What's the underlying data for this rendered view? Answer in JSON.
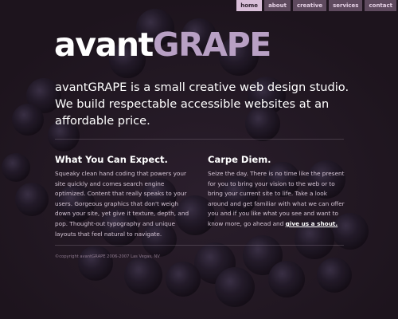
{
  "nav": {
    "items": [
      {
        "label": "home",
        "active": true
      },
      {
        "label": "about",
        "active": false
      },
      {
        "label": "creative",
        "active": false
      },
      {
        "label": "services",
        "active": false
      },
      {
        "label": "contact",
        "active": false
      }
    ]
  },
  "logo": {
    "part1": "avant",
    "part2": "GRAPE"
  },
  "intro": "avantGRAPE is a small creative web design studio. We build respectable accessible websites at an affordable price.",
  "columns": {
    "left": {
      "title": "What You Can Expect.",
      "text": "Squeaky clean hand coding that powers your site quickly and comes search engine optimized. Content that really speaks to your users. Gorgeous graphics that don't weigh down your site, yet give it texture, depth, and pop. Thought-out typography and unique layouts that feel natural to navigate."
    },
    "right": {
      "title": "Carpe Diem.",
      "text": "Seize the day. There is no time like the present for you to bring your vision to the web or to bring your current site to life. Take a look around and get familiar with what we can offer you and if you like what you see and want to know more, go ahead and",
      "link": "give us a shout."
    }
  },
  "footer": "©copyright avantGRAPE 2006-2007 Las Vegas, NV",
  "colors": {
    "background": "#1d141d",
    "accent": "#b8a0c4",
    "nav_active": "#d8bed8",
    "nav_inactive": "#5e4a5e"
  }
}
